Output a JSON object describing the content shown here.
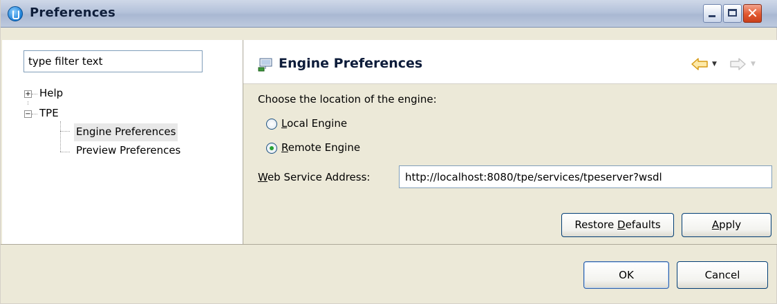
{
  "window": {
    "title": "Preferences"
  },
  "filter": {
    "placeholder": "type filter text",
    "value": "type filter text"
  },
  "tree": {
    "help": {
      "label": "Help",
      "toggle": "+"
    },
    "tpe": {
      "label": "TPE",
      "toggle": "−"
    },
    "engine_prefs": {
      "label": "Engine Preferences",
      "selected": true
    },
    "preview_prefs": {
      "label": "Preview Preferences"
    }
  },
  "header": {
    "title": "Engine Preferences",
    "icon": "engine-preferences-icon",
    "back_icon": "back-arrow-icon",
    "forward_icon": "forward-arrow-icon",
    "dropdown_glyph": "▼"
  },
  "engine": {
    "choose_label": "Choose the location of the engine:",
    "local": {
      "mnemonic": "L",
      "rest": "ocal Engine",
      "checked": false
    },
    "remote": {
      "mnemonic": "R",
      "rest": "emote Engine",
      "checked": true
    },
    "wsa": {
      "mnemonic": "W",
      "rest": "eb Service Address:",
      "value": "http://localhost:8080/tpe/services/tpeserver?wsdl"
    }
  },
  "buttons": {
    "restore": {
      "pre": "Restore ",
      "mnemonic": "D",
      "post": "efaults"
    },
    "apply": {
      "mnemonic": "A",
      "post": "pply"
    },
    "ok": "OK",
    "cancel": "Cancel"
  },
  "colors": {
    "accent": "#0a246a",
    "radio_checked": "#27a233"
  }
}
